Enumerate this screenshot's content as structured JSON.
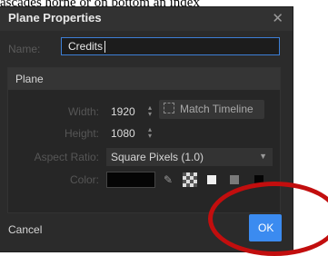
{
  "caption": "ascades horne or on bottom an index",
  "dialog": {
    "title": "Plane Properties",
    "close_glyph": "✕",
    "name_label": "Name:",
    "name_value": "Credits"
  },
  "plane": {
    "heading": "Plane",
    "width_label": "Width:",
    "width_value": "1920",
    "height_label": "Height:",
    "height_value": "1080",
    "match_label": "Match Timeline",
    "aspect_label": "Aspect Ratio:",
    "aspect_value": "Square Pixels (1.0)",
    "color_label": "Color:",
    "color_value": "#050505",
    "swatches": [
      "#f0f0f0",
      "#7a7a7a",
      "#050505"
    ]
  },
  "footer": {
    "cancel_label": "Cancel",
    "ok_label": "OK"
  },
  "colors": {
    "accent": "#3b8bf0",
    "annotation": "#c20e0e"
  },
  "icons": {
    "close": "close-icon",
    "spin": "spin-arrows-icon",
    "match": "fit-frame-icon",
    "dropdown": "chevron-down-icon",
    "eyedropper": "eyedropper-icon",
    "transparent": "checkerboard-icon"
  }
}
